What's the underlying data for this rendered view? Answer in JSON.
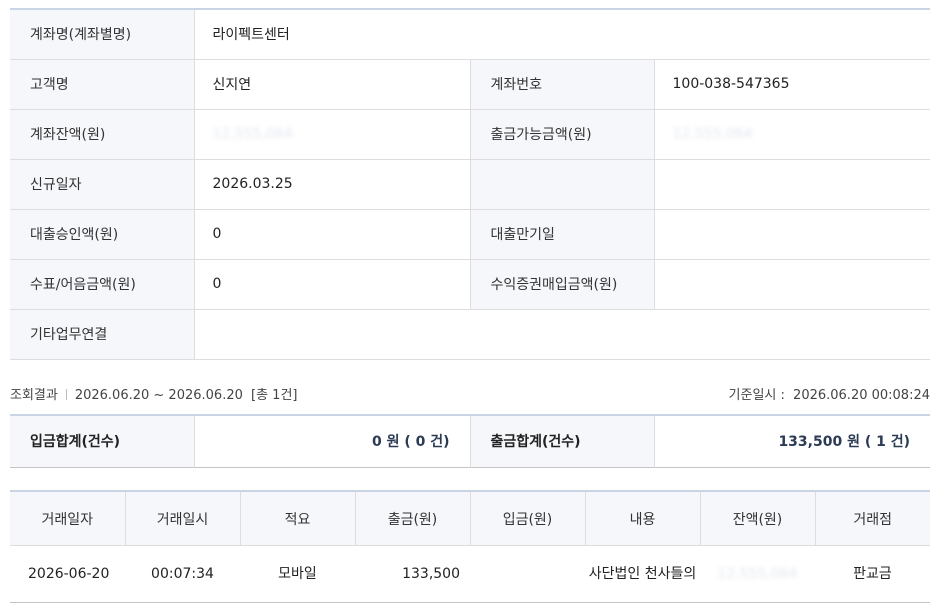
{
  "account_info": {
    "account_name_label": "계좌명(계좌별명)",
    "account_name_value": "라이펙트센터",
    "customer_name_label": "고객명",
    "customer_name_value": "신지연",
    "account_number_label": "계좌번호",
    "account_number_value": "100-038-547365",
    "balance_label": "계좌잔액(원)",
    "balance_value": "12,555,064",
    "withdrawable_label": "출금가능금액(원)",
    "withdrawable_value": "12,555,064",
    "open_date_label": "신규일자",
    "open_date_value": "2026.03.25",
    "loan_approval_label": "대출승인액(원)",
    "loan_approval_value": "0",
    "loan_maturity_label": "대출만기일",
    "loan_maturity_value": "",
    "check_bill_label": "수표/어음금액(원)",
    "check_bill_value": "0",
    "securities_label": "수익증권매입금액(원)",
    "securities_value": "",
    "other_link_label": "기타업무연결",
    "other_link_value": ""
  },
  "query": {
    "result_label": "조회결과",
    "period": "2026.06.20 ~ 2026.06.20",
    "count_text": "[총 1건]",
    "base_time_label": "기준일시 :",
    "base_time_value": "2026.06.20 00:08:24"
  },
  "summary": {
    "deposit_label": "입금합계(건수)",
    "deposit_value": "0 원 ( 0 건)",
    "withdraw_label": "출금합계(건수)",
    "withdraw_value": "133,500 원 ( 1 건)"
  },
  "transactions": {
    "headers": [
      "거래일자",
      "거래일시",
      "적요",
      "출금(원)",
      "입금(원)",
      "내용",
      "잔액(원)",
      "거래점"
    ],
    "rows": [
      {
        "date": "2026-06-20",
        "time": "00:07:34",
        "memo": "모바일",
        "withdraw": "133,500",
        "deposit": "",
        "content": "사단법인 천사들의",
        "balance": "12,555,064",
        "branch": "판교금"
      }
    ]
  },
  "colors": {
    "header_bg": "#f6f7fb",
    "top_border": "#c9d4e4",
    "summary_value": "#2b3a55"
  }
}
